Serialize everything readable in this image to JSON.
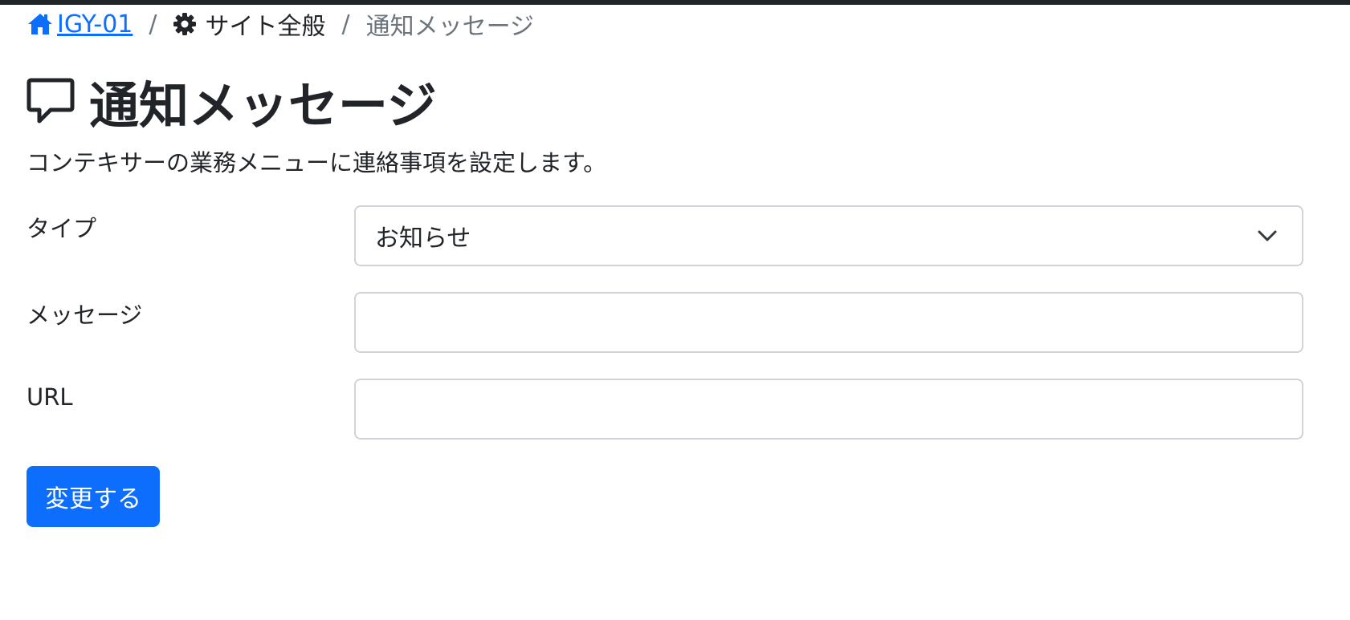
{
  "breadcrumb": {
    "home_label": "IGY-01",
    "home_icon": "home-icon",
    "separator": "/",
    "section_label": "サイト全般",
    "section_icon": "gear-icon",
    "current_label": "通知メッセージ"
  },
  "header": {
    "title": "通知メッセージ",
    "icon": "chat-bubble-icon",
    "description": "コンテキサーの業務メニューに連絡事項を設定します。"
  },
  "form": {
    "type_label": "タイプ",
    "type_value": "お知らせ",
    "message_label": "メッセージ",
    "message_value": "",
    "url_label": "URL",
    "url_value": "",
    "submit_label": "変更する"
  },
  "colors": {
    "accent": "#0d6efd",
    "text": "#212529",
    "muted": "#6c757d",
    "border": "#ced4da",
    "top_bar": "#212529"
  }
}
